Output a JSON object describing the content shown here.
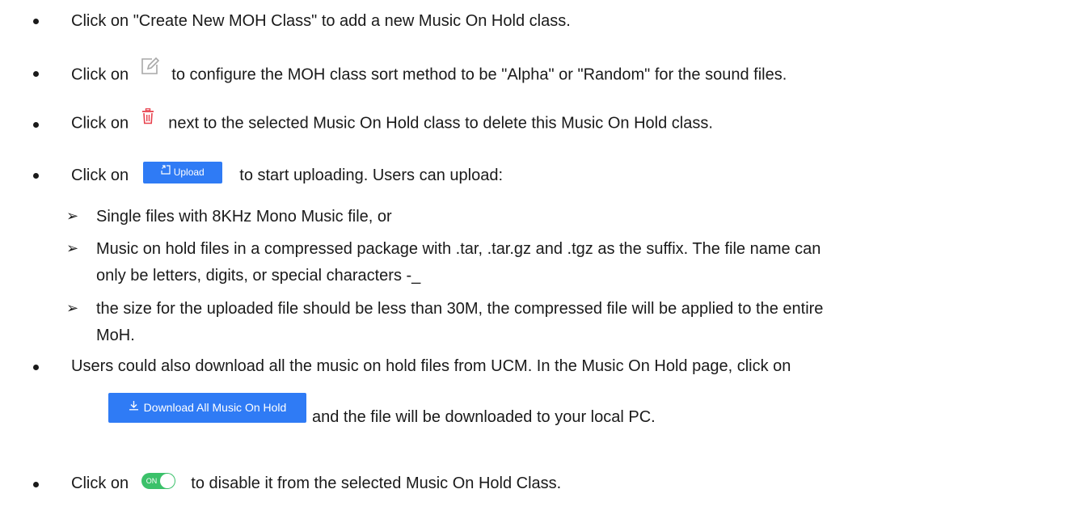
{
  "bullets": {
    "b1": "Click on \"Create New MOH Class\" to add a new Music On Hold class.",
    "b2_prefix": "Click on",
    "b2_suffix": "to configure the MOH class sort method to be \"Alpha\" or \"Random\" for the sound files.",
    "b3_prefix": "Click on",
    "b3_suffix": "next to the selected Music On Hold class to delete this Music On Hold class.",
    "b4_prefix": "Click on",
    "b4_suffix": "to start uploading. Users can upload:",
    "b5_line1": "Users could also download all the music on hold files from UCM. In the Music On Hold page, click on",
    "b5_line2": "and the file will be downloaded to your local PC.",
    "b6_prefix": "Click on",
    "b6_suffix": "to disable it from the selected Music On Hold Class."
  },
  "sub_items": {
    "s1": "Single files with 8KHz Mono Music file, or",
    "s2_line1": "Music on hold files in a compressed package with .tar, .tar.gz and .tgz as the suffix. The file name can",
    "s2_line2": "only be letters, digits, or special characters -_",
    "s3_line1": "the size for the uploaded file should be less than 30M, the compressed file will be applied to the entire",
    "s3_line2": "MoH."
  },
  "buttons": {
    "upload_label": "Upload",
    "download_label": "Download All Music On Hold",
    "toggle_label": "ON"
  },
  "icons": {
    "edit": "edit-icon",
    "delete": "delete-icon",
    "upload": "upload-icon",
    "download": "download-icon"
  },
  "colors": {
    "button_blue": "#2f7bf5",
    "toggle_green": "#3bc16a",
    "delete_red": "#e8424e",
    "edit_gray": "#a8a8a8"
  }
}
